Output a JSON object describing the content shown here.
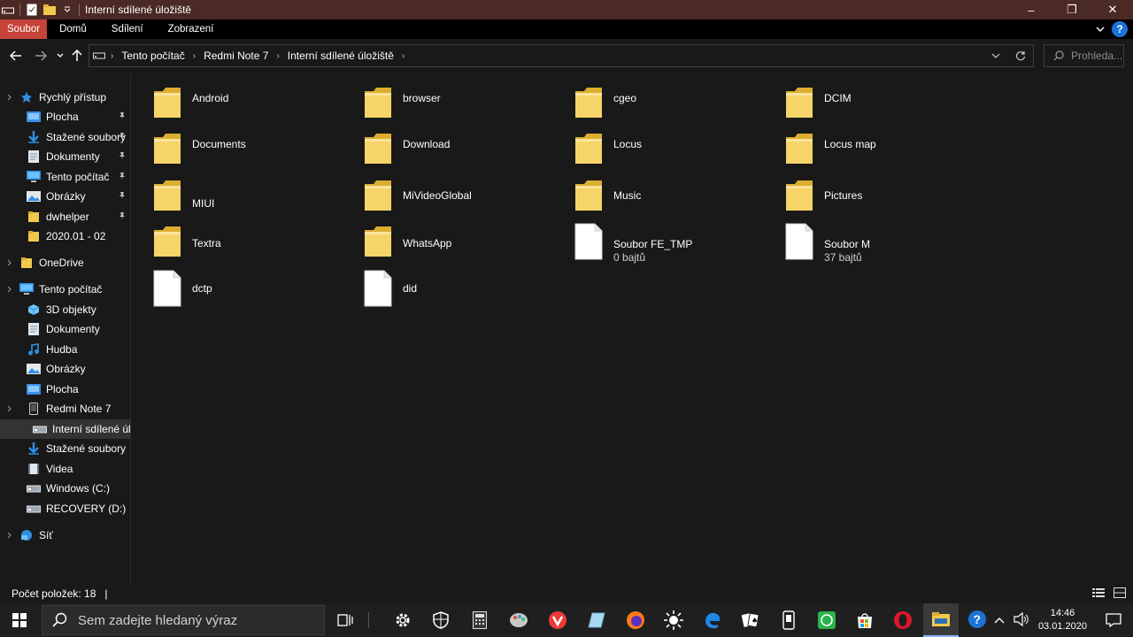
{
  "window": {
    "title": "Interní sdílené úložiště",
    "buttons": {
      "minimize": "–",
      "maximize": "❐",
      "close": "✕"
    }
  },
  "ribbon": {
    "tabs": [
      "Soubor",
      "Domů",
      "Sdílení",
      "Zobrazení"
    ],
    "accent_color": "#c6433a"
  },
  "address": {
    "breadcrumb": [
      "Tento počítač",
      "Redmi Note 7",
      "Interní sdílené úložiště"
    ],
    "search_placeholder": "Prohleda..."
  },
  "sidebar": {
    "items": [
      {
        "label": "Rychlý přístup",
        "icon": "star-icon",
        "pinned": false
      },
      {
        "label": "Plocha",
        "icon": "desktop-folder-icon",
        "pinned": true
      },
      {
        "label": "Stažené soubory",
        "icon": "download-icon",
        "pinned": true
      },
      {
        "label": "Dokumenty",
        "icon": "documents-icon",
        "pinned": true
      },
      {
        "label": "Tento počítač",
        "icon": "computer-icon",
        "pinned": true
      },
      {
        "label": "Obrázky",
        "icon": "pictures-icon",
        "pinned": true
      },
      {
        "label": "dwhelper",
        "icon": "folder-icon",
        "pinned": true
      },
      {
        "label": "2020.01 - 02",
        "icon": "folder-icon",
        "pinned": false
      },
      {
        "label": "OneDrive",
        "icon": "folder-icon",
        "pinned": false
      },
      {
        "label": "Tento počítač",
        "icon": "computer-icon",
        "pinned": false
      },
      {
        "label": "3D objekty",
        "icon": "cube-icon",
        "pinned": false
      },
      {
        "label": "Dokumenty",
        "icon": "documents-icon",
        "pinned": false
      },
      {
        "label": "Hudba",
        "icon": "music-icon",
        "pinned": false
      },
      {
        "label": "Obrázky",
        "icon": "pictures-icon",
        "pinned": false
      },
      {
        "label": "Plocha",
        "icon": "desktop-folder-icon",
        "pinned": false
      },
      {
        "label": "Redmi Note 7",
        "icon": "phone-icon",
        "pinned": false
      },
      {
        "label": "Interní sdílené úlo",
        "icon": "drive-icon",
        "pinned": false,
        "selected": true
      },
      {
        "label": "Stažené soubory",
        "icon": "download-icon",
        "pinned": false
      },
      {
        "label": "Videa",
        "icon": "video-icon",
        "pinned": false
      },
      {
        "label": "Windows (C:)",
        "icon": "drive-icon",
        "pinned": false
      },
      {
        "label": "RECOVERY (D:)",
        "icon": "drive-icon",
        "pinned": false
      },
      {
        "label": "Síť",
        "icon": "network-icon",
        "pinned": false
      }
    ]
  },
  "files": [
    {
      "name": "Android",
      "type": "folder"
    },
    {
      "name": "browser",
      "type": "folder"
    },
    {
      "name": "cgeo",
      "type": "folder"
    },
    {
      "name": "DCIM",
      "type": "folder"
    },
    {
      "name": "Documents",
      "type": "folder"
    },
    {
      "name": "Download",
      "type": "folder"
    },
    {
      "name": "Locus",
      "type": "folder"
    },
    {
      "name": "Locus map",
      "type": "folder"
    },
    {
      "name": "MIUI",
      "type": "folder"
    },
    {
      "name": "MiVideoGlobal",
      "type": "folder"
    },
    {
      "name": "Music",
      "type": "folder"
    },
    {
      "name": "Pictures",
      "type": "folder"
    },
    {
      "name": "Textra",
      "type": "folder"
    },
    {
      "name": "WhatsApp",
      "type": "folder"
    },
    {
      "name": "Soubor FE_TMP",
      "type": "file",
      "size": "0 bajtů"
    },
    {
      "name": "Soubor M",
      "type": "file",
      "size": "37 bajtů"
    },
    {
      "name": "dctp",
      "type": "file"
    },
    {
      "name": "did",
      "type": "file"
    }
  ],
  "status": {
    "item_count": "Počet položek: 18",
    "cursor": "|"
  },
  "taskbar": {
    "search_placeholder": "Sem zadejte hledaný výraz",
    "time": "14:46",
    "date": "03.01.2020"
  }
}
